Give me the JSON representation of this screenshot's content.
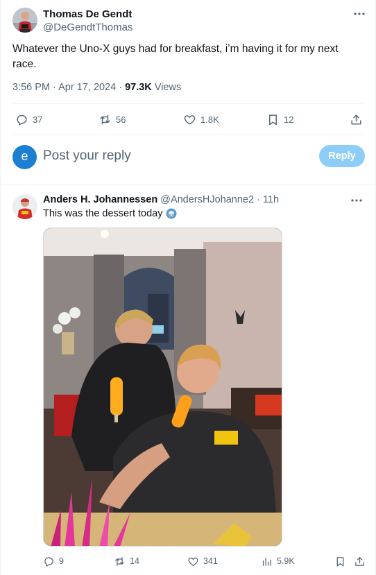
{
  "main_tweet": {
    "author_name": "Thomas De Gendt",
    "author_handle": "@DeGendtThomas",
    "text": "Whatever the Uno-X guys had for breakfast, i’m having it for my next race.",
    "time": "3:56 PM",
    "separator": "·",
    "date": "Apr 17, 2024",
    "views_count": "97.3K",
    "views_label": "Views",
    "more_icon": "more-horizontal-icon",
    "actions": {
      "replies": "37",
      "reposts": "56",
      "likes": "1.8K",
      "bookmarks": "12"
    }
  },
  "reply_composer": {
    "avatar_letter": "e",
    "placeholder": "Post your reply",
    "button_label": "Reply"
  },
  "reply_tweet": {
    "author_name": "Anders H. Johannessen",
    "author_handle": "@AndersHJohanne2",
    "time_ago": "· 11h",
    "text": "This was the dessert today",
    "emoji": "ice-cream-emoji",
    "actions": {
      "replies": "9",
      "reposts": "14",
      "likes": "341",
      "views": "5.9K"
    }
  },
  "colors": {
    "text_primary": "#0f1419",
    "text_secondary": "#536471",
    "border": "#eff3f4",
    "reply_button_disabled": "#8ecdf8",
    "avatar_blue": "#1d7fd1"
  }
}
